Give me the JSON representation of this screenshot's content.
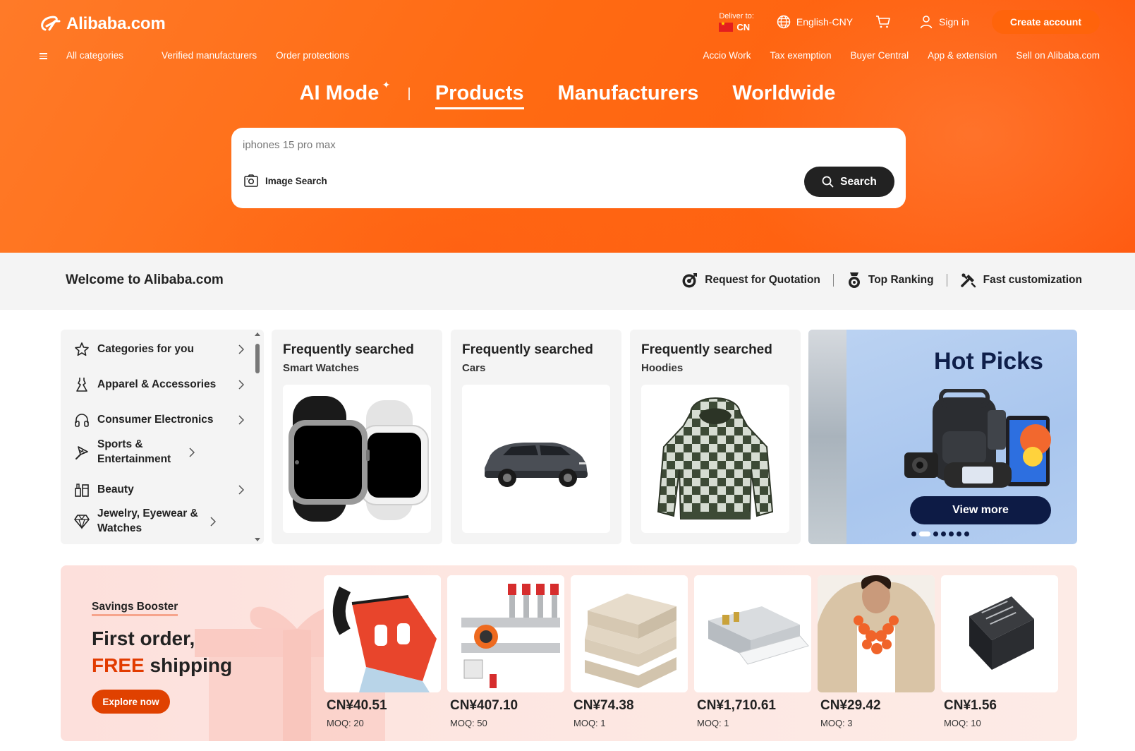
{
  "header": {
    "logo_text": "Alibaba.com",
    "deliver_label": "Deliver to:",
    "deliver_country": "CN",
    "language": "English-CNY",
    "sign_in": "Sign in",
    "create_account": "Create account"
  },
  "subnav": {
    "left": [
      "All categories",
      "Verified manufacturers",
      "Order protections"
    ],
    "right": [
      "Accio Work",
      "Tax exemption",
      "Buyer Central",
      "App & extension",
      "Sell on Alibaba.com"
    ]
  },
  "mode_tabs": {
    "ai_mode": "AI Mode",
    "products": "Products",
    "manufacturers": "Manufacturers",
    "worldwide": "Worldwide",
    "active": "Products"
  },
  "search": {
    "placeholder": "iphones 15 pro max",
    "image_search": "Image Search",
    "button": "Search"
  },
  "welcome": {
    "title": "Welcome to Alibaba.com",
    "links": [
      "Request for Quotation",
      "Top Ranking",
      "Fast customization"
    ]
  },
  "categories": [
    {
      "label": "Categories for you",
      "icon": "star-icon"
    },
    {
      "label": "Apparel & Accessories",
      "icon": "dress-icon"
    },
    {
      "label": "Consumer Electronics",
      "icon": "headphones-icon"
    },
    {
      "label": "Sports & Entertainment",
      "icon": "badminton-icon"
    },
    {
      "label": "Beauty",
      "icon": "cosmetics-icon"
    },
    {
      "label": "Jewelry, Eyewear & Watches",
      "icon": "diamond-icon"
    }
  ],
  "frequent": [
    {
      "title": "Frequently searched",
      "subtitle": "Smart Watches"
    },
    {
      "title": "Frequently searched",
      "subtitle": "Cars"
    },
    {
      "title": "Frequently searched",
      "subtitle": "Hoodies"
    }
  ],
  "hot_picks": {
    "title": "Hot Picks",
    "button": "View more",
    "slide_count": 7,
    "active_slide": 2
  },
  "savings": {
    "label": "Savings Booster",
    "line1": "First order,",
    "line2_highlight": "FREE",
    "line2_rest": " shipping",
    "button": "Explore now",
    "products": [
      {
        "price": "CN¥40.51",
        "moq": "MOQ: 20"
      },
      {
        "price": "CN¥407.10",
        "moq": "MOQ: 50"
      },
      {
        "price": "CN¥74.38",
        "moq": "MOQ: 1"
      },
      {
        "price": "CN¥1,710.61",
        "moq": "MOQ: 1"
      },
      {
        "price": "CN¥29.42",
        "moq": "MOQ: 3"
      },
      {
        "price": "CN¥1.56",
        "moq": "MOQ: 10"
      }
    ]
  },
  "colors": {
    "brand_orange": "#ff6a12",
    "dark_button": "#222222",
    "accent_red": "#e23b00",
    "hot_picks_navy": "#0d1b45"
  }
}
